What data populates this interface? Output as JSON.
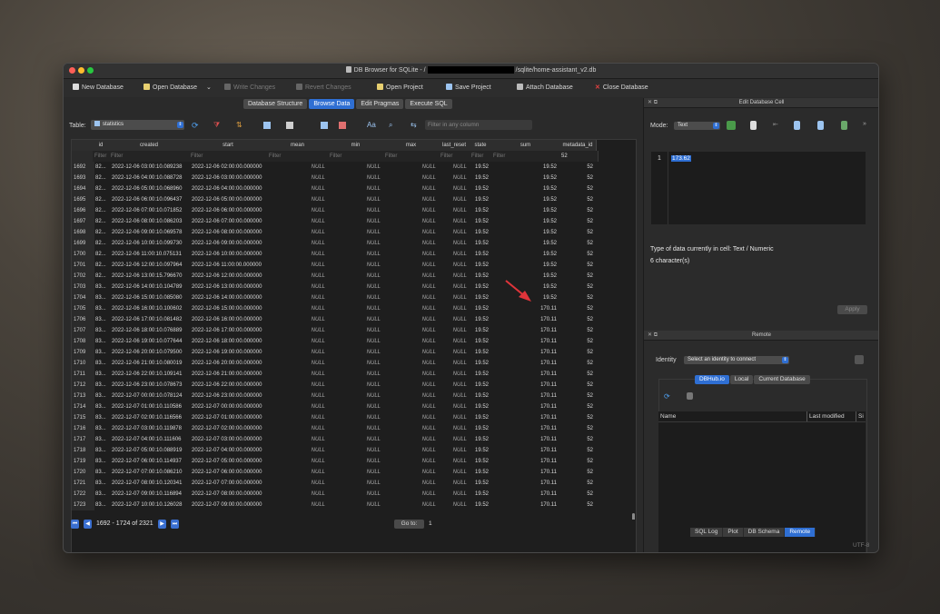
{
  "window": {
    "title_prefix": "DB Browser for SQLite - /",
    "title_suffix": "/sqlite/home-assistant_v2.db"
  },
  "toolbar": {
    "new_database": "New Database",
    "open_database": "Open Database",
    "write_changes": "Write Changes",
    "revert_changes": "Revert Changes",
    "open_project": "Open Project",
    "save_project": "Save Project",
    "attach_database": "Attach Database",
    "close_database": "Close Database"
  },
  "tabs": [
    "Database Structure",
    "Browse Data",
    "Edit Pragmas",
    "Execute SQL"
  ],
  "browse": {
    "table_label": "Table:",
    "table_value": "statistics",
    "filter_placeholder": "Filter in any column",
    "filter_text": "Filter",
    "filter_last": "52",
    "columns": [
      "id",
      "created",
      "start",
      "mean",
      "min",
      "max",
      "last_reset",
      "state",
      "sum",
      "metadata_id"
    ],
    "rows": [
      [
        "1692",
        "82...",
        "2022-12-06 03:00:10.089238",
        "2022-12-06 02:00:00.000000",
        "NULL",
        "NULL",
        "NULL",
        "NULL",
        "19.52",
        "19.52",
        "52"
      ],
      [
        "1693",
        "82...",
        "2022-12-06 04:00:10.088728",
        "2022-12-06 03:00:00.000000",
        "NULL",
        "NULL",
        "NULL",
        "NULL",
        "19.52",
        "19.52",
        "52"
      ],
      [
        "1694",
        "82...",
        "2022-12-06 05:00:10.068960",
        "2022-12-06 04:00:00.000000",
        "NULL",
        "NULL",
        "NULL",
        "NULL",
        "19.52",
        "19.52",
        "52"
      ],
      [
        "1695",
        "82...",
        "2022-12-06 06:00:10.096437",
        "2022-12-06 05:00:00.000000",
        "NULL",
        "NULL",
        "NULL",
        "NULL",
        "19.52",
        "19.52",
        "52"
      ],
      [
        "1696",
        "82...",
        "2022-12-06 07:00:10.071852",
        "2022-12-06 06:00:00.000000",
        "NULL",
        "NULL",
        "NULL",
        "NULL",
        "19.52",
        "19.52",
        "52"
      ],
      [
        "1697",
        "82...",
        "2022-12-06 08:00:10.086203",
        "2022-12-06 07:00:00.000000",
        "NULL",
        "NULL",
        "NULL",
        "NULL",
        "19.52",
        "19.52",
        "52"
      ],
      [
        "1698",
        "82...",
        "2022-12-06 09:00:10.069578",
        "2022-12-06 08:00:00.000000",
        "NULL",
        "NULL",
        "NULL",
        "NULL",
        "19.52",
        "19.52",
        "52"
      ],
      [
        "1699",
        "82...",
        "2022-12-06 10:00:10.099730",
        "2022-12-06 09:00:00.000000",
        "NULL",
        "NULL",
        "NULL",
        "NULL",
        "19.52",
        "19.52",
        "52"
      ],
      [
        "1700",
        "82...",
        "2022-12-06 11:00:10.075131",
        "2022-12-06 10:00:00.000000",
        "NULL",
        "NULL",
        "NULL",
        "NULL",
        "19.52",
        "19.52",
        "52"
      ],
      [
        "1701",
        "82...",
        "2022-12-06 12:00:10.097964",
        "2022-12-06 11:00:00.000000",
        "NULL",
        "NULL",
        "NULL",
        "NULL",
        "19.52",
        "19.52",
        "52"
      ],
      [
        "1702",
        "82...",
        "2022-12-06 13:00:15.796670",
        "2022-12-06 12:00:00.000000",
        "NULL",
        "NULL",
        "NULL",
        "NULL",
        "19.52",
        "19.52",
        "52"
      ],
      [
        "1703",
        "83...",
        "2022-12-06 14:00:10.104789",
        "2022-12-06 13:00:00.000000",
        "NULL",
        "NULL",
        "NULL",
        "NULL",
        "19.52",
        "19.52",
        "52"
      ],
      [
        "1704",
        "83...",
        "2022-12-06 15:00:10.085080",
        "2022-12-06 14:00:00.000000",
        "NULL",
        "NULL",
        "NULL",
        "NULL",
        "19.52",
        "19.52",
        "52"
      ],
      [
        "1705",
        "83...",
        "2022-12-06 16:00:10.100602",
        "2022-12-06 15:00:00.000000",
        "NULL",
        "NULL",
        "NULL",
        "NULL",
        "19.52",
        "170.11",
        "52"
      ],
      [
        "1706",
        "83...",
        "2022-12-06 17:00:10.081482",
        "2022-12-06 16:00:00.000000",
        "NULL",
        "NULL",
        "NULL",
        "NULL",
        "19.52",
        "170.11",
        "52"
      ],
      [
        "1707",
        "83...",
        "2022-12-06 18:00:10.076889",
        "2022-12-06 17:00:00.000000",
        "NULL",
        "NULL",
        "NULL",
        "NULL",
        "19.52",
        "170.11",
        "52"
      ],
      [
        "1708",
        "83...",
        "2022-12-06 19:00:10.077644",
        "2022-12-06 18:00:00.000000",
        "NULL",
        "NULL",
        "NULL",
        "NULL",
        "19.52",
        "170.11",
        "52"
      ],
      [
        "1709",
        "83...",
        "2022-12-06 20:00:10.079500",
        "2022-12-06 19:00:00.000000",
        "NULL",
        "NULL",
        "NULL",
        "NULL",
        "19.52",
        "170.11",
        "52"
      ],
      [
        "1710",
        "83...",
        "2022-12-06 21:00:10.080019",
        "2022-12-06 20:00:00.000000",
        "NULL",
        "NULL",
        "NULL",
        "NULL",
        "19.52",
        "170.11",
        "52"
      ],
      [
        "1711",
        "83...",
        "2022-12-06 22:00:10.109141",
        "2022-12-06 21:00:00.000000",
        "NULL",
        "NULL",
        "NULL",
        "NULL",
        "19.52",
        "170.11",
        "52"
      ],
      [
        "1712",
        "83...",
        "2022-12-06 23:00:10.078673",
        "2022-12-06 22:00:00.000000",
        "NULL",
        "NULL",
        "NULL",
        "NULL",
        "19.52",
        "170.11",
        "52"
      ],
      [
        "1713",
        "83...",
        "2022-12-07 00:00:10.078124",
        "2022-12-06 23:00:00.000000",
        "NULL",
        "NULL",
        "NULL",
        "NULL",
        "19.52",
        "170.11",
        "52"
      ],
      [
        "1714",
        "83...",
        "2022-12-07 01:00:10.110586",
        "2022-12-07 00:00:00.000000",
        "NULL",
        "NULL",
        "NULL",
        "NULL",
        "19.52",
        "170.11",
        "52"
      ],
      [
        "1715",
        "83...",
        "2022-12-07 02:00:10.116566",
        "2022-12-07 01:00:00.000000",
        "NULL",
        "NULL",
        "NULL",
        "NULL",
        "19.52",
        "170.11",
        "52"
      ],
      [
        "1716",
        "83...",
        "2022-12-07 03:00:10.119878",
        "2022-12-07 02:00:00.000000",
        "NULL",
        "NULL",
        "NULL",
        "NULL",
        "19.52",
        "170.11",
        "52"
      ],
      [
        "1717",
        "83...",
        "2022-12-07 04:00:10.111606",
        "2022-12-07 03:00:00.000000",
        "NULL",
        "NULL",
        "NULL",
        "NULL",
        "19.52",
        "170.11",
        "52"
      ],
      [
        "1718",
        "83...",
        "2022-12-07 05:00:10.088919",
        "2022-12-07 04:00:00.000000",
        "NULL",
        "NULL",
        "NULL",
        "NULL",
        "19.52",
        "170.11",
        "52"
      ],
      [
        "1719",
        "83...",
        "2022-12-07 06:00:10.114937",
        "2022-12-07 05:00:00.000000",
        "NULL",
        "NULL",
        "NULL",
        "NULL",
        "19.52",
        "170.11",
        "52"
      ],
      [
        "1720",
        "83...",
        "2022-12-07 07:00:10.086210",
        "2022-12-07 06:00:00.000000",
        "NULL",
        "NULL",
        "NULL",
        "NULL",
        "19.52",
        "170.11",
        "52"
      ],
      [
        "1721",
        "83...",
        "2022-12-07 08:00:10.120341",
        "2022-12-07 07:00:00.000000",
        "NULL",
        "NULL",
        "NULL",
        "NULL",
        "19.52",
        "170.11",
        "52"
      ],
      [
        "1722",
        "83...",
        "2022-12-07 09:00:10.116894",
        "2022-12-07 08:00:00.000000",
        "NULL",
        "NULL",
        "NULL",
        "NULL",
        "19.52",
        "170.11",
        "52"
      ],
      [
        "1723",
        "83...",
        "2022-12-07 10:00:10.126028",
        "2022-12-07 09:00:00.000000",
        "NULL",
        "NULL",
        "NULL",
        "NULL",
        "19.52",
        "170.11",
        "52"
      ]
    ],
    "pager": "1692 - 1724 of 2321",
    "goto_label": "Go to:",
    "goto_value": "1"
  },
  "edit_cell": {
    "header": "Edit Database Cell",
    "mode_label": "Mode:",
    "mode_value": "Text",
    "line_number": "1",
    "cell_value": "173.62",
    "type_info": "Type of data currently in cell: Text / Numeric",
    "char_count": "6 character(s)",
    "apply": "Apply"
  },
  "remote": {
    "header": "Remote",
    "identity_label": "Identity",
    "identity_value": "Select an identity to connect",
    "tabs": [
      "DBHub.io",
      "Local",
      "Current Database"
    ],
    "columns": [
      "Name",
      "Last modified",
      "Si"
    ]
  },
  "bottom_tabs": [
    "SQL Log",
    "Plot",
    "DB Schema",
    "Remote"
  ],
  "encoding": "UTF-8",
  "colors": {
    "accent": "#2f6fd3",
    "arrow": "#e0343a"
  }
}
